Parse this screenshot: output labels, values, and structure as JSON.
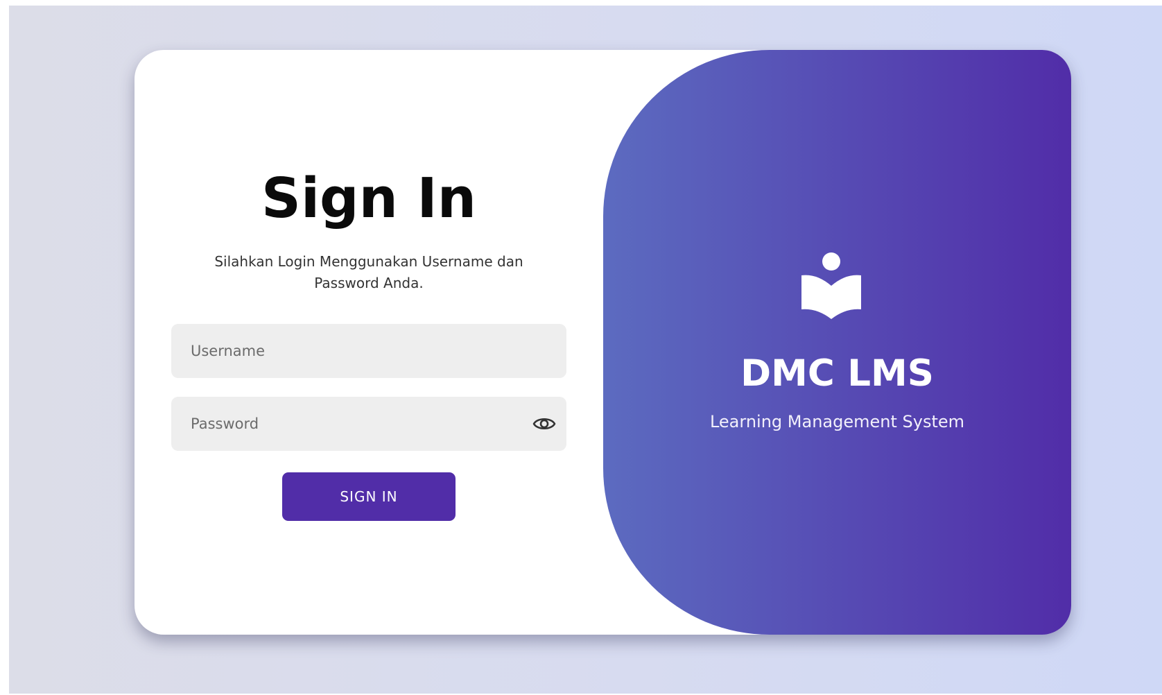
{
  "signin": {
    "title": "Sign In",
    "subtitle": "Silahkan Login Menggunakan Username dan Password Anda.",
    "username": {
      "placeholder": "Username",
      "value": ""
    },
    "password": {
      "placeholder": "Password",
      "value": ""
    },
    "submit_label": "SIGN IN"
  },
  "brand": {
    "name": "DMC LMS",
    "tagline": "Learning Management System",
    "logo_icon": "reader-book-icon"
  },
  "icons": {
    "password_toggle": "eye-icon"
  },
  "colors": {
    "accent": "#512da8",
    "gradient_start": "#5c6bc0",
    "gradient_end": "#512da8",
    "field_background": "#eeeeee"
  }
}
